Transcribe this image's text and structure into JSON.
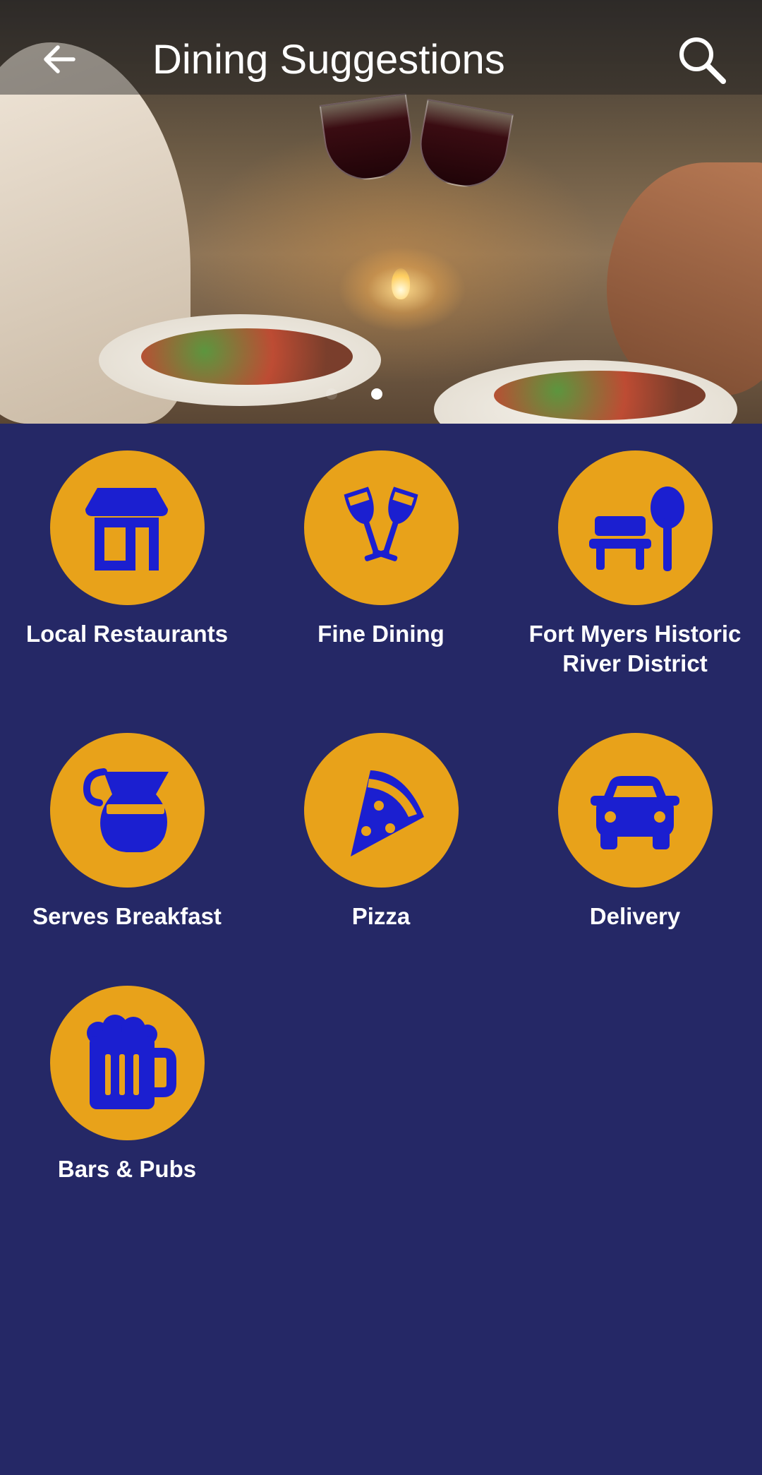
{
  "header": {
    "title": "Dining Suggestions",
    "back_icon": "arrow-left-icon",
    "search_icon": "search-icon"
  },
  "banner": {
    "slide_count": 2,
    "active_slide": 2
  },
  "colors": {
    "background": "#252866",
    "icon_circle": "#e8a21a",
    "icon_glyph": "#1b1fd0",
    "label": "#ffffff"
  },
  "categories": [
    {
      "label": "Local Restaurants",
      "icon": "storefront-icon"
    },
    {
      "label": "Fine Dining",
      "icon": "wine-glasses-icon"
    },
    {
      "label": "Fort Myers Historic River District",
      "icon": "bench-tree-icon"
    },
    {
      "label": "Serves Breakfast",
      "icon": "coffee-pot-icon"
    },
    {
      "label": "Pizza",
      "icon": "pizza-slice-icon"
    },
    {
      "label": "Delivery",
      "icon": "car-icon"
    },
    {
      "label": "Bars & Pubs",
      "icon": "beer-mug-icon"
    }
  ]
}
